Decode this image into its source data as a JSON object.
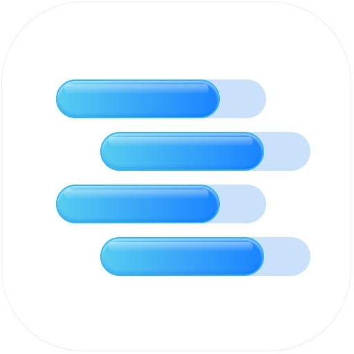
{
  "app_icon": {
    "icon": "horizontal-bars-list-icon",
    "colors": {
      "tile_background": "#ffffff",
      "tile_border": "#ececec",
      "bar_track": "#c9e1fb",
      "bar_fill_start": "#56cdf2",
      "bar_fill_end": "#1a84ff"
    },
    "bars": [
      {
        "fill_fraction": 0.78
      },
      {
        "fill_fraction": 0.78
      },
      {
        "fill_fraction": 0.78
      },
      {
        "fill_fraction": 0.78
      }
    ]
  }
}
